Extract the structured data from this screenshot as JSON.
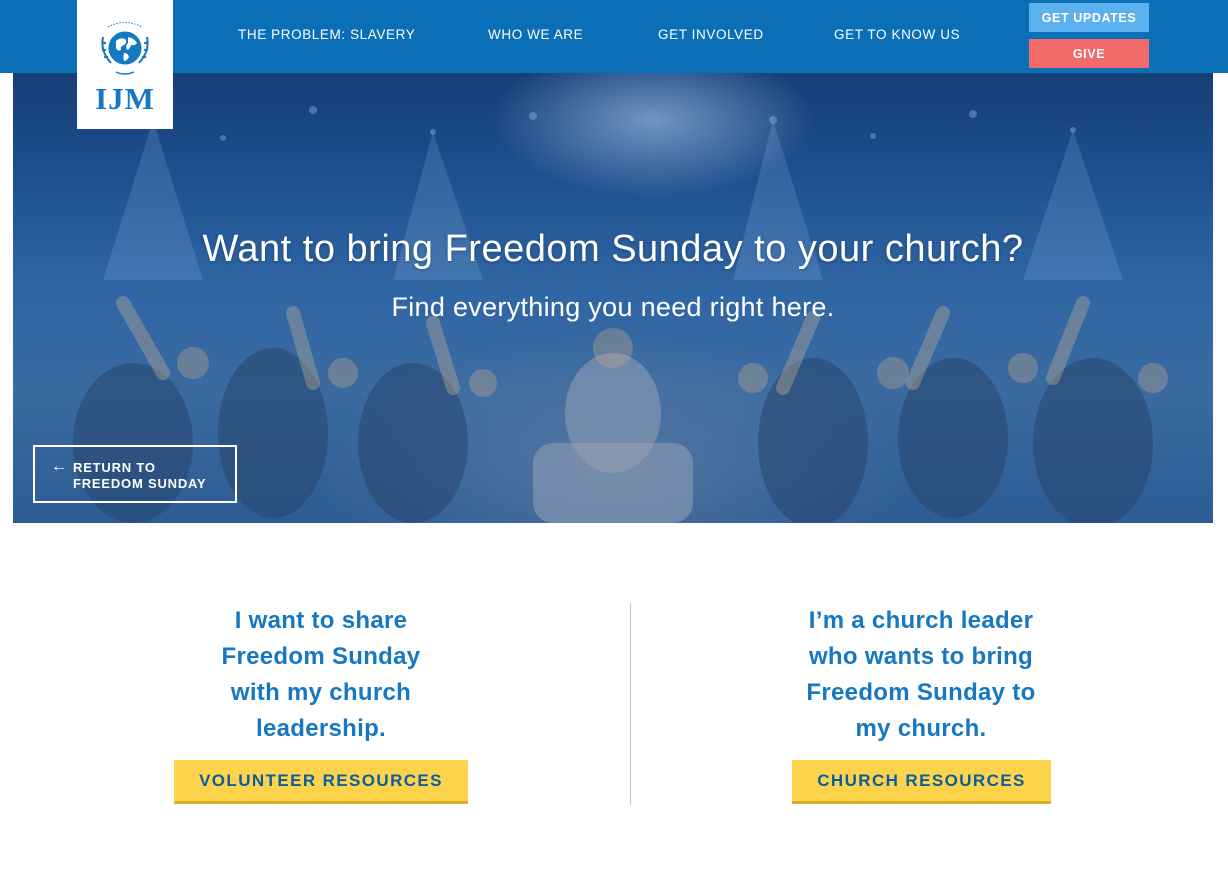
{
  "header": {
    "logo_text": "IJM",
    "nav": [
      "THE PROBLEM: SLAVERY",
      "WHO WE ARE",
      "GET INVOLVED",
      "GET TO KNOW US"
    ],
    "updates_label": "GET UPDATES",
    "give_label": "GIVE"
  },
  "hero": {
    "title": "Want to bring Freedom Sunday to your church?",
    "subtitle": "Find everything you need right here.",
    "return_arrow": "←",
    "return_line1": "RETURN TO",
    "return_line2": "FREEDOM SUNDAY"
  },
  "left": {
    "lines": [
      "I want to share",
      "Freedom Sunday",
      "with my church",
      "leadership."
    ],
    "button": "VOLUNTEER RESOURCES"
  },
  "right": {
    "lines": [
      "I’m a church leader",
      "who wants to bring",
      "Freedom Sunday to",
      "my church."
    ],
    "button": "CHURCH RESOURCES"
  },
  "colors": {
    "brand_blue": "#0b6fb8",
    "heading_blue": "#1677c2",
    "updates": "#5bb0ee",
    "give": "#f46a6a",
    "cta_yellow": "#fcd34a"
  }
}
